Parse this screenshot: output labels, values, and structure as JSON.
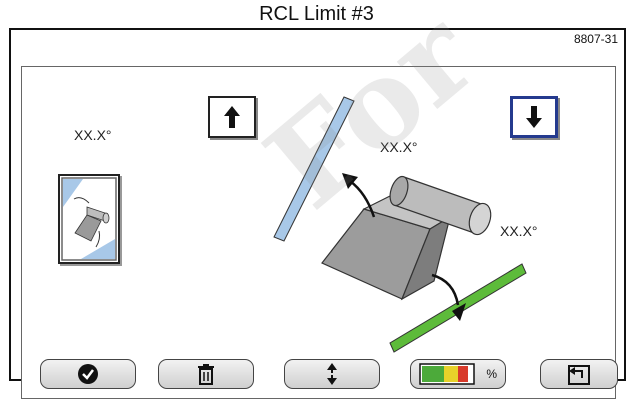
{
  "header": {
    "title": "RCL Limit #3",
    "figure_id": "8807-31"
  },
  "readouts": {
    "top_left": "XX.X°",
    "upper_limit": "XX.X°",
    "lower_limit": "XX.X°"
  },
  "buttons": {
    "up_arrow": "up-arrow-icon",
    "down_arrow": "down-arrow-icon",
    "confirm": "check-circle-icon",
    "delete": "trash-icon",
    "toggle_limits": "vertical-arrows-icon",
    "percent_label": "%",
    "back": "return-icon"
  },
  "limit_colors": {
    "upper": "#a8c8e8",
    "lower": "#5dbb3a",
    "selected_border": "#243a8e"
  },
  "percent_gauge_colors": [
    "#4caa3a",
    "#e8d22a",
    "#d83a2a"
  ],
  "watermark": "For reference"
}
